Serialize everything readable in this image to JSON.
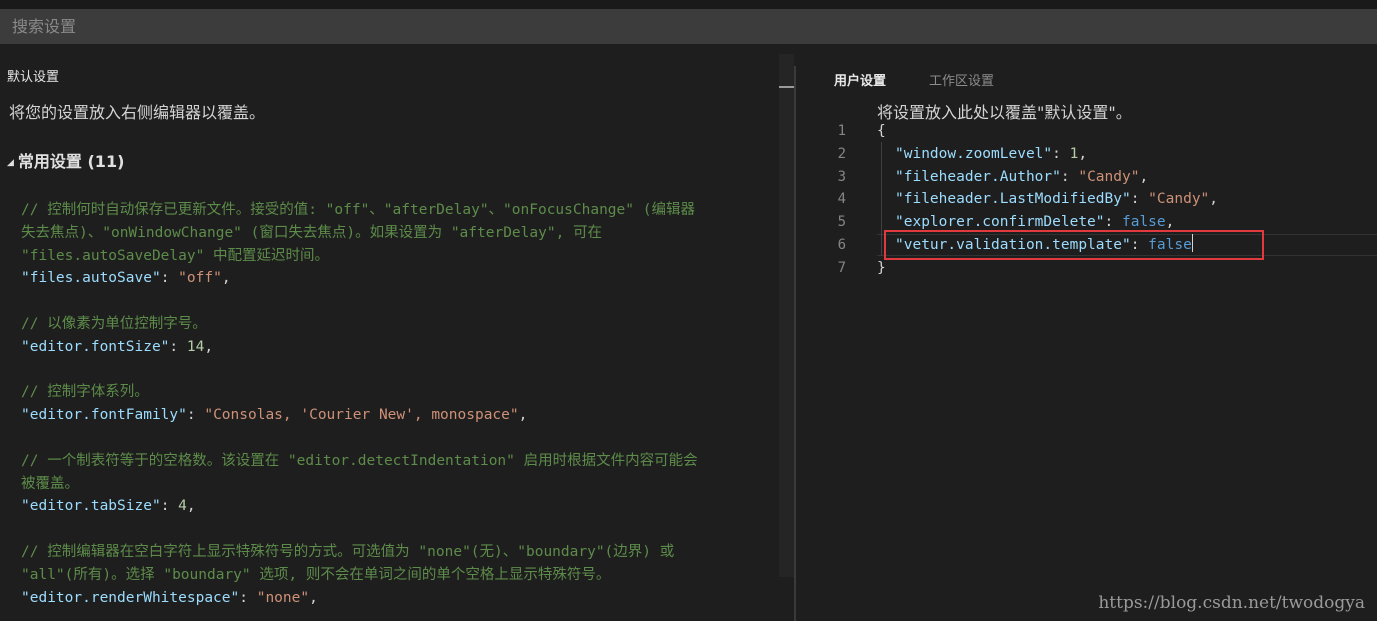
{
  "search": {
    "placeholder": "搜索设置"
  },
  "left": {
    "header": "默认设置",
    "subtitle": "将您的设置放入右侧编辑器以覆盖。",
    "section": {
      "title": "常用设置 (11)"
    },
    "lines": [
      [
        {
          "t": "comment",
          "v": "// 控制何时自动保存已更新文件。接受的值: \"off\"、\"afterDelay\"、\"onFocusChange\" (编辑器"
        }
      ],
      [
        {
          "t": "comment",
          "v": "失去焦点)、\"onWindowChange\" (窗口失去焦点)。如果设置为 \"afterDelay\", 可在"
        }
      ],
      [
        {
          "t": "comment",
          "v": "\"files.autoSaveDelay\" 中配置延迟时间。"
        }
      ],
      [
        {
          "t": "key",
          "v": "\"files.autoSave\""
        },
        {
          "t": "punc",
          "v": ": "
        },
        {
          "t": "str",
          "v": "\"off\""
        },
        {
          "t": "punc",
          "v": ","
        }
      ],
      [],
      [
        {
          "t": "comment",
          "v": "// 以像素为单位控制字号。"
        }
      ],
      [
        {
          "t": "key",
          "v": "\"editor.fontSize\""
        },
        {
          "t": "punc",
          "v": ": "
        },
        {
          "t": "num",
          "v": "14"
        },
        {
          "t": "punc",
          "v": ","
        }
      ],
      [],
      [
        {
          "t": "comment",
          "v": "// 控制字体系列。"
        }
      ],
      [
        {
          "t": "key",
          "v": "\"editor.fontFamily\""
        },
        {
          "t": "punc",
          "v": ": "
        },
        {
          "t": "str",
          "v": "\"Consolas, 'Courier New', monospace\""
        },
        {
          "t": "punc",
          "v": ","
        }
      ],
      [],
      [
        {
          "t": "comment",
          "v": "// 一个制表符等于的空格数。该设置在 \"editor.detectIndentation\" 启用时根据文件内容可能会"
        }
      ],
      [
        {
          "t": "comment",
          "v": "被覆盖。"
        }
      ],
      [
        {
          "t": "key",
          "v": "\"editor.tabSize\""
        },
        {
          "t": "punc",
          "v": ": "
        },
        {
          "t": "num",
          "v": "4"
        },
        {
          "t": "punc",
          "v": ","
        }
      ],
      [],
      [
        {
          "t": "comment",
          "v": "// 控制编辑器在空白字符上显示特殊符号的方式。可选值为 \"none\"(无)、\"boundary\"(边界) 或"
        }
      ],
      [
        {
          "t": "comment",
          "v": "\"all\"(所有)。选择 \"boundary\" 选项, 则不会在单词之间的单个空格上显示特殊符号。"
        }
      ],
      [
        {
          "t": "key",
          "v": "\"editor.renderWhitespace\""
        },
        {
          "t": "punc",
          "v": ": "
        },
        {
          "t": "str",
          "v": "\"none\""
        },
        {
          "t": "punc",
          "v": ","
        }
      ]
    ]
  },
  "right": {
    "tabs": [
      {
        "label": "用户设置",
        "active": true
      },
      {
        "label": "工作区设置",
        "active": false
      }
    ],
    "subtitle": "将设置放入此处以覆盖\"默认设置\"。",
    "lines": [
      {
        "n": "1",
        "indent": false,
        "tokens": [
          {
            "t": "punc",
            "v": "{"
          }
        ]
      },
      {
        "n": "2",
        "indent": true,
        "tokens": [
          {
            "t": "key",
            "v": "\"window.zoomLevel\""
          },
          {
            "t": "punc",
            "v": ": "
          },
          {
            "t": "num",
            "v": "1"
          },
          {
            "t": "punc",
            "v": ","
          }
        ]
      },
      {
        "n": "3",
        "indent": true,
        "tokens": [
          {
            "t": "key",
            "v": "\"fileheader.Author\""
          },
          {
            "t": "punc",
            "v": ": "
          },
          {
            "t": "str",
            "v": "\"Candy\""
          },
          {
            "t": "punc",
            "v": ","
          }
        ]
      },
      {
        "n": "4",
        "indent": true,
        "tokens": [
          {
            "t": "key",
            "v": "\"fileheader.LastModifiedBy\""
          },
          {
            "t": "punc",
            "v": ": "
          },
          {
            "t": "str",
            "v": "\"Candy\""
          },
          {
            "t": "punc",
            "v": ","
          }
        ]
      },
      {
        "n": "5",
        "indent": true,
        "tokens": [
          {
            "t": "key",
            "v": "\"explorer.confirmDelete\""
          },
          {
            "t": "punc",
            "v": ": "
          },
          {
            "t": "kw",
            "v": "false"
          },
          {
            "t": "punc",
            "v": ","
          }
        ]
      },
      {
        "n": "6",
        "indent": true,
        "tokens": [
          {
            "t": "key",
            "v": "\"vetur.validation.template\""
          },
          {
            "t": "punc",
            "v": ": "
          },
          {
            "t": "kw",
            "v": "false"
          }
        ],
        "cursor": true
      },
      {
        "n": "7",
        "indent": false,
        "tokens": [
          {
            "t": "punc",
            "v": "}"
          }
        ]
      }
    ]
  },
  "watermark": "https://blog.csdn.net/twodogya",
  "colors": {
    "background": "#1e1e1e",
    "search_bar": "#3c3c3c",
    "comment": "#5d8c4a",
    "key": "#9cdcfe",
    "string": "#ce9178",
    "number": "#b5cea8",
    "keyword": "#569cd6",
    "highlight_box": "#e0393e"
  }
}
